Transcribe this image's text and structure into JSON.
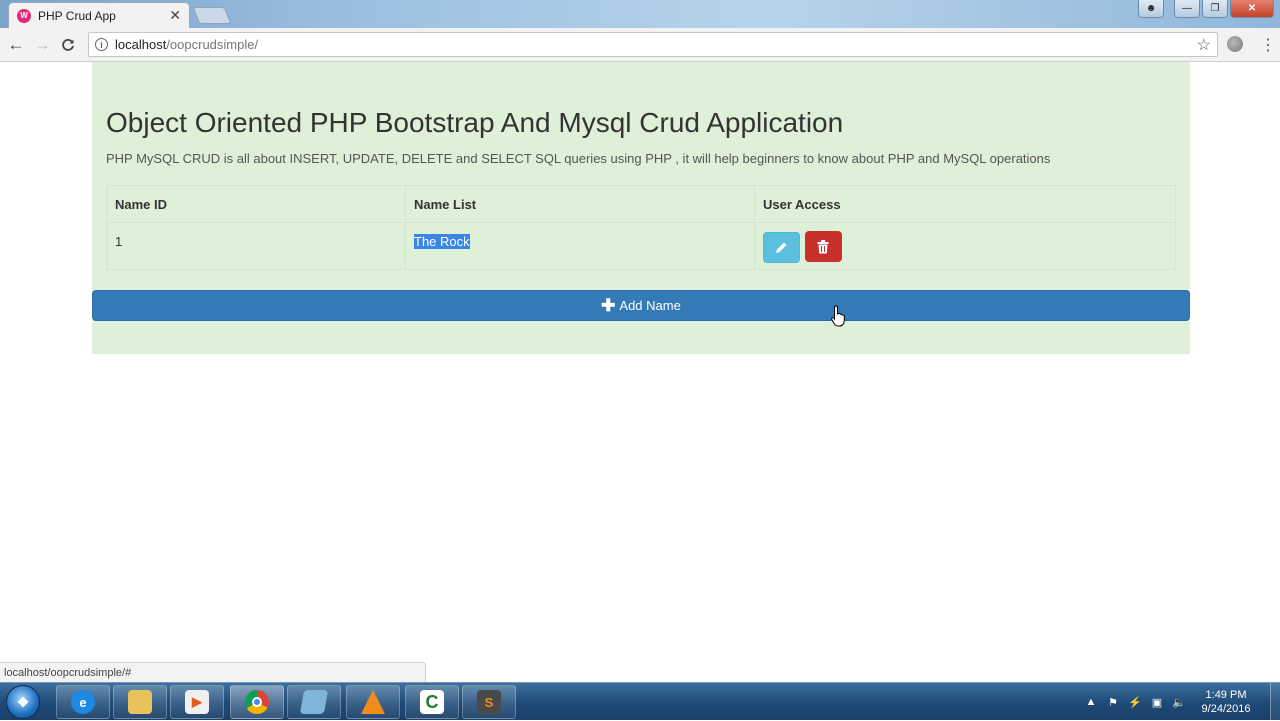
{
  "browser": {
    "tab_title": "PHP Crud App",
    "tab_close": "✕",
    "url_host": "localhost",
    "url_path": "/oopcrudsimple/",
    "status_url": "localhost/oopcrudsimple/#"
  },
  "page": {
    "heading": "Object Oriented PHP Bootstrap And Mysql Crud Application",
    "subtitle": "PHP MySQL CRUD is all about INSERT, UPDATE, DELETE and SELECT SQL queries using PHP , it will help beginners to know about PHP and MySQL operations",
    "table": {
      "headers": [
        "Name ID",
        "Name List",
        "User Access"
      ],
      "rows": [
        {
          "id": "1",
          "name": "The Rock"
        }
      ]
    },
    "add_button_label": "Add Name"
  },
  "taskbar": {
    "time": "1:49 PM",
    "date": "9/24/2016"
  },
  "colors": {
    "container_bg": "#dff0d8",
    "primary": "#337ab7",
    "info": "#5bc0de",
    "danger": "#c9302c"
  },
  "icons": {
    "edit": "pencil-icon",
    "delete": "trash-icon",
    "add": "plus-icon"
  }
}
